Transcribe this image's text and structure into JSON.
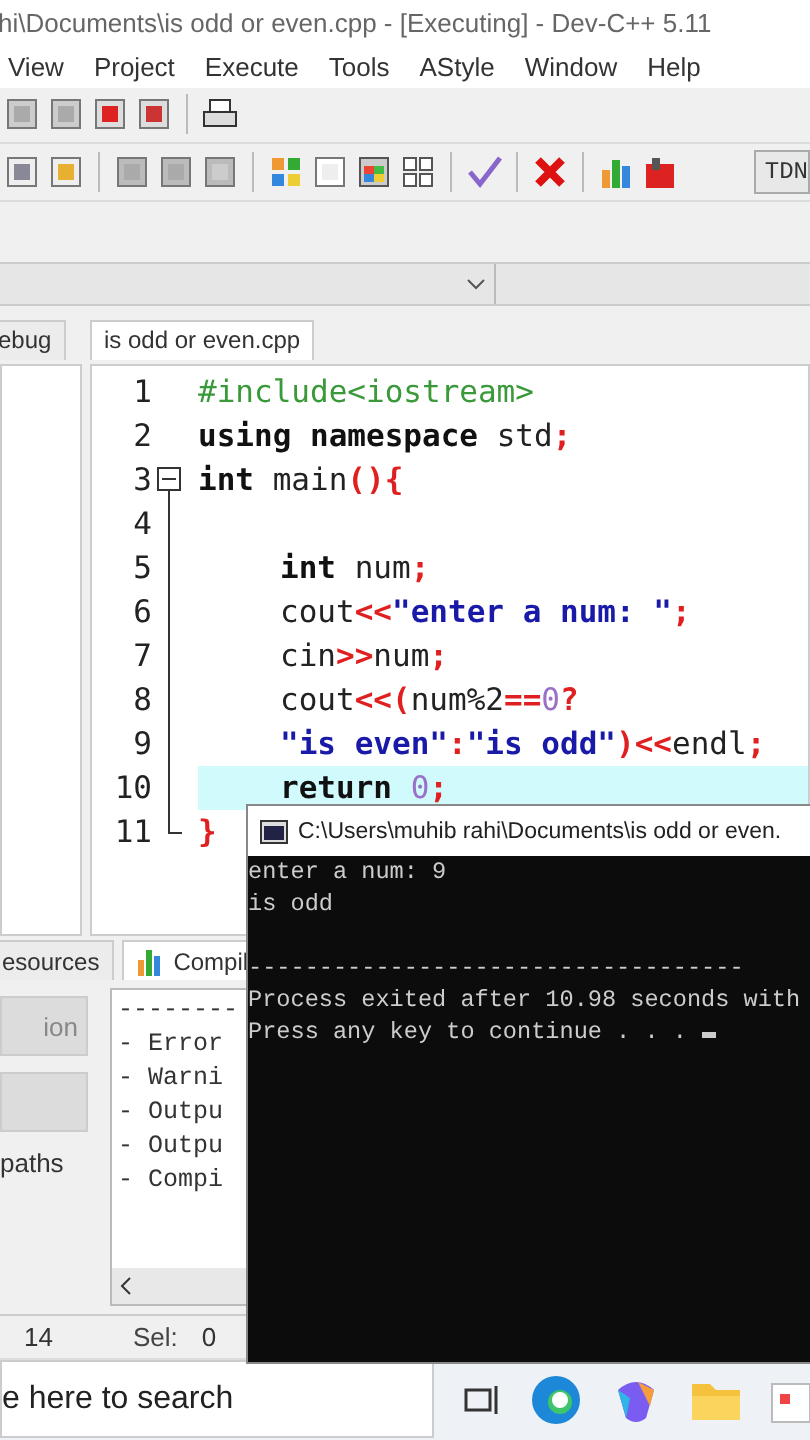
{
  "window": {
    "title": "hi\\Documents\\is odd or even.cpp - [Executing] - Dev-C++ 5.11"
  },
  "menu": [
    "View",
    "Project",
    "Execute",
    "Tools",
    "AStyle",
    "Window",
    "Help"
  ],
  "toolbar": {
    "combo_text": "TDN"
  },
  "left_tabs": [
    {
      "label": "ebug",
      "selected": false
    }
  ],
  "editor_tabs": [
    {
      "label": "is odd or even.cpp",
      "selected": true
    }
  ],
  "code_lines": [
    {
      "number": "1",
      "indented": false,
      "highlighted": false,
      "tokens": [
        {
          "kind": "pre",
          "text": "#include<iostream>"
        }
      ]
    },
    {
      "number": "2",
      "indented": false,
      "highlighted": false,
      "tokens": [
        {
          "kind": "keyword",
          "text": "using namespace"
        },
        {
          "kind": "plain",
          "text": " std"
        },
        {
          "kind": "symbol",
          "text": ";"
        }
      ]
    },
    {
      "number": "3",
      "indented": false,
      "highlighted": false,
      "fold_start": true,
      "in_fold": false,
      "fold_end": false,
      "tokens": [
        {
          "kind": "keyword",
          "text": "int"
        },
        {
          "kind": "plain",
          "text": " main"
        },
        {
          "kind": "symbol",
          "text": "(){"
        }
      ]
    },
    {
      "number": "4",
      "highlighted": false,
      "fold_start": false,
      "in_fold": true,
      "fold_end": false
    },
    {
      "number": "5",
      "indented": true,
      "highlighted": false,
      "fold_start": false,
      "in_fold": true,
      "fold_end": false,
      "tokens": [
        {
          "kind": "keyword",
          "text": "int"
        },
        {
          "kind": "plain",
          "text": " num"
        },
        {
          "kind": "symbol",
          "text": ";"
        }
      ]
    },
    {
      "number": "6",
      "indented": true,
      "highlighted": false,
      "fold_start": false,
      "in_fold": true,
      "fold_end": false,
      "tokens": [
        {
          "kind": "plain",
          "text": "cout"
        },
        {
          "kind": "symbol",
          "text": "<<"
        },
        {
          "kind": "string",
          "text": "\"enter a num: \""
        },
        {
          "kind": "symbol",
          "text": ";"
        }
      ]
    },
    {
      "number": "7",
      "indented": true,
      "highlighted": false,
      "fold_start": false,
      "in_fold": true,
      "fold_end": false,
      "tokens": [
        {
          "kind": "plain",
          "text": "cin"
        },
        {
          "kind": "symbol",
          "text": ">>"
        },
        {
          "kind": "plain",
          "text": "num"
        },
        {
          "kind": "symbol",
          "text": ";"
        }
      ]
    },
    {
      "number": "8",
      "indented": true,
      "highlighted": false,
      "fold_start": false,
      "in_fold": true,
      "fold_end": false,
      "tokens": [
        {
          "kind": "plain",
          "text": "cout"
        },
        {
          "kind": "symbol",
          "text": "<<("
        },
        {
          "kind": "plain",
          "text": "num%2"
        },
        {
          "kind": "symbol",
          "text": "=="
        },
        {
          "kind": "number",
          "text": "0"
        },
        {
          "kind": "symbol",
          "text": "?"
        }
      ]
    },
    {
      "number": "9",
      "indented": true,
      "highlighted": false,
      "fold_start": false,
      "in_fold": true,
      "fold_end": false,
      "tokens": [
        {
          "kind": "string",
          "text": "\"is even\""
        },
        {
          "kind": "symbol",
          "text": ":"
        },
        {
          "kind": "string",
          "text": "\"is odd\""
        },
        {
          "kind": "symbol",
          "text": ")<<"
        },
        {
          "kind": "plain",
          "text": "endl"
        },
        {
          "kind": "symbol",
          "text": ";"
        }
      ]
    },
    {
      "number": "10",
      "indented": true,
      "highlighted": true,
      "fold_start": false,
      "in_fold": true,
      "fold_end": false,
      "tokens": [
        {
          "kind": "keyword",
          "text": "return "
        },
        {
          "kind": "number",
          "text": "0"
        },
        {
          "kind": "symbol",
          "text": ";"
        }
      ]
    },
    {
      "number": "11",
      "indented": false,
      "highlighted": false,
      "fold_start": false,
      "in_fold": false,
      "fold_end": true,
      "tokens": [
        {
          "kind": "symbol",
          "text": "}"
        }
      ]
    }
  ],
  "bottom_tabs": [
    {
      "label": "esources",
      "selected": false,
      "icon": false
    },
    {
      "label": "Compil",
      "selected": true,
      "icon": true
    }
  ],
  "bottom_left": {
    "buttons": [
      {
        "label": "ion",
        "disabled": true
      },
      {
        "disabled": true
      }
    ],
    "label": "paths"
  },
  "compile_log": [
    "--------",
    "- Error",
    "- Warni",
    "- Outpu",
    "- Outpu",
    "- Compi"
  ],
  "status_bar": [
    {
      "kind": "value",
      "text": "14"
    },
    {
      "kind": "label",
      "text": "Sel:"
    },
    {
      "kind": "value",
      "text": "0"
    }
  ],
  "console": {
    "title": "C:\\Users\\muhib rahi\\Documents\\is odd or even.",
    "output": [
      "enter a num: 9",
      "is odd"
    ],
    "footer": [
      "-----------------------------------",
      "Process exited after 10.98 seconds with",
      "Press any key to continue . . . "
    ]
  },
  "taskbar": {
    "search": {
      "placeholder": "e here to search"
    }
  }
}
